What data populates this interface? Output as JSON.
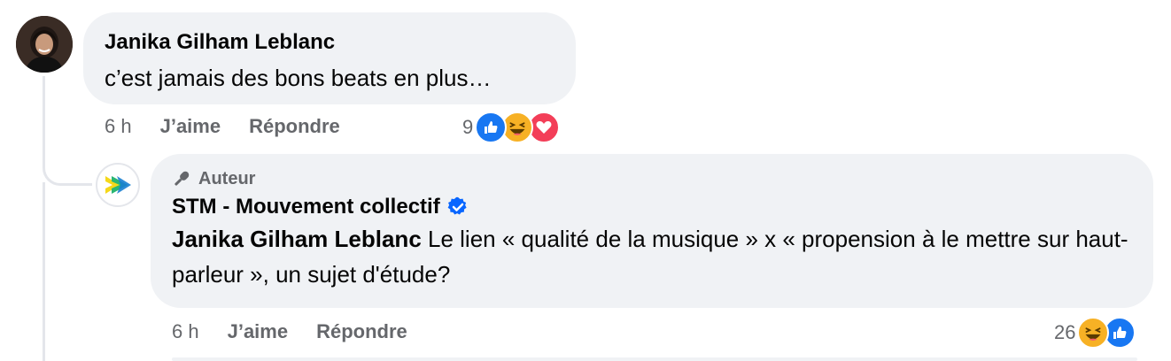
{
  "comment": {
    "author": "Janika Gilham Leblanc",
    "text": "c’est jamais des bons beats en plus…",
    "time": "6 h",
    "like_label": "J’aime",
    "reply_label": "Répondre",
    "reaction_count": "9",
    "reactions": [
      "like-icon",
      "haha-icon",
      "love-icon"
    ]
  },
  "reply": {
    "badge": "Auteur",
    "author": "STM - Mouvement collectif",
    "verified": true,
    "mention": "Janika Gilham Leblanc",
    "text": " Le lien « qualité de la musique » x « propension à le mettre sur haut-parleur », un sujet d'étude?",
    "time": "6 h",
    "like_label": "J’aime",
    "reply_label": "Répondre",
    "reaction_count": "26",
    "reactions": [
      "haha-icon",
      "like-icon"
    ]
  },
  "colors": {
    "bubble": "#f0f2f5",
    "secondary_text": "#65676b",
    "like_blue": "#1877f2",
    "love_red": "#f33e58",
    "haha_yellow": "#f7b125",
    "verified_blue": "#0866ff"
  }
}
